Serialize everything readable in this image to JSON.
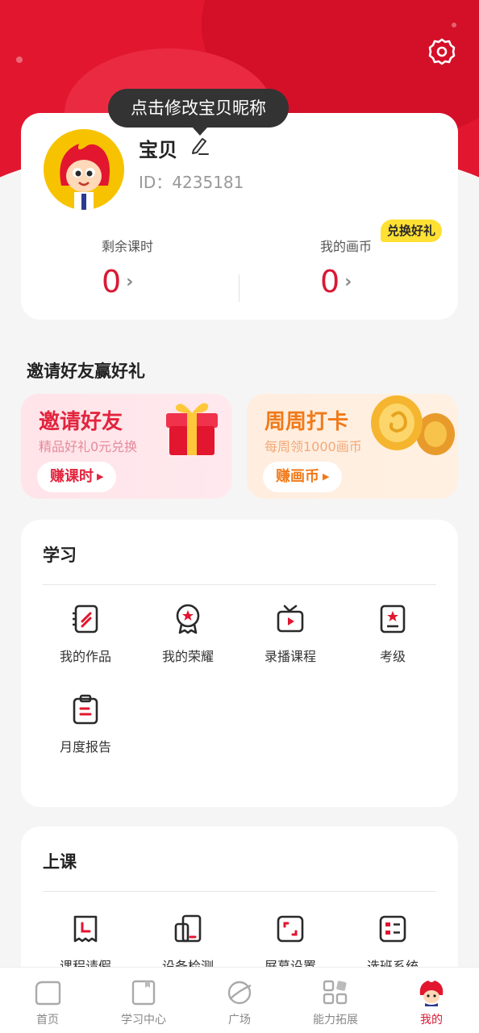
{
  "tooltip": "点击修改宝贝昵称",
  "profile": {
    "nickname": "宝贝",
    "id_label": "ID：",
    "id_value": "4235181",
    "remaining_label": "剩余课时",
    "remaining_value": "0",
    "coins_label": "我的画币",
    "coins_value": "0",
    "redeem_tag": "兑换好礼"
  },
  "invite_section_title": "邀请好友赢好礼",
  "promos": [
    {
      "title": "邀请好友",
      "subtitle": "精品好礼0元兑换",
      "button": "赚课时"
    },
    {
      "title": "周周打卡",
      "subtitle": "每周领1000画币",
      "button": "赚画币"
    }
  ],
  "study": {
    "title": "学习",
    "items": [
      {
        "label": "我的作品",
        "icon": "artwork-icon"
      },
      {
        "label": "我的荣耀",
        "icon": "medal-icon"
      },
      {
        "label": "录播课程",
        "icon": "tv-play-icon"
      },
      {
        "label": "考级",
        "icon": "exam-icon"
      },
      {
        "label": "月度报告",
        "icon": "clipboard-icon"
      }
    ]
  },
  "classes": {
    "title": "上课",
    "items": [
      {
        "label": "课程请假",
        "icon": "leave-icon"
      },
      {
        "label": "设备检测",
        "icon": "device-check-icon"
      },
      {
        "label": "屏幕设置",
        "icon": "screen-icon"
      },
      {
        "label": "选班系统",
        "icon": "class-select-icon"
      }
    ]
  },
  "tabs": [
    {
      "label": "首页",
      "icon": "home-icon"
    },
    {
      "label": "学习中心",
      "icon": "book-icon"
    },
    {
      "label": "广场",
      "icon": "planet-icon"
    },
    {
      "label": "能力拓展",
      "icon": "grid-icon"
    },
    {
      "label": "我的",
      "icon": "mascot-icon"
    }
  ],
  "colors": {
    "brand_red": "#e2162f",
    "value_red": "#d81a34",
    "invite_title": "#e2243d",
    "checkin_title": "#f07a1a",
    "redeem_yellow": "#ffe033"
  }
}
